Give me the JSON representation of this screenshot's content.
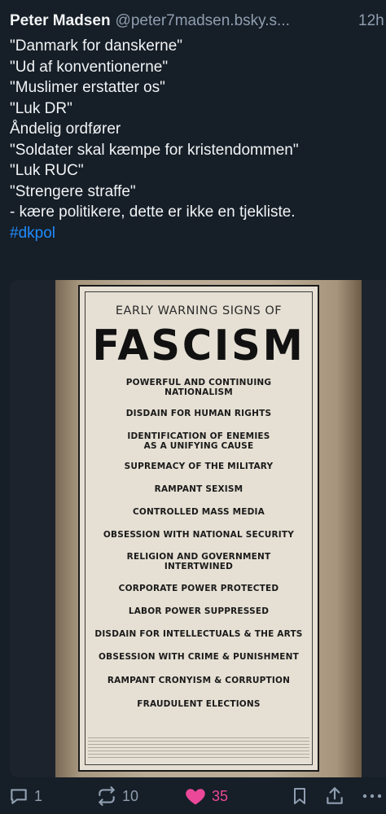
{
  "post": {
    "author_name": "Peter Madsen",
    "author_handle": "@peter7madsen.bsky.s...",
    "time": "12h",
    "lines": [
      "\"Danmark for danskerne\"",
      "\"Ud af konventionerne\"",
      "\"Muslimer erstatter os\"",
      "\"Luk DR\"",
      "Åndelig ordfører",
      "\"Soldater skal kæmpe for kristendommen\"",
      "\"Luk RUC\"",
      "\"Strengere straffe\"",
      " - kære politikere, dette er ikke en tjekliste."
    ],
    "hashtag": "#dkpol"
  },
  "poster": {
    "subtitle": "EARLY WARNING SIGNS OF",
    "title": "FASCISM",
    "signs": [
      "POWERFUL AND CONTINUING\nNATIONALISM",
      "DISDAIN FOR HUMAN RIGHTS",
      "IDENTIFICATION OF ENEMIES\nAS A UNIFYING CAUSE",
      "SUPREMACY OF THE MILITARY",
      "RAMPANT SEXISM",
      "CONTROLLED MASS MEDIA",
      "OBSESSION WITH NATIONAL SECURITY",
      "RELIGION AND GOVERNMENT\nINTERTWINED",
      "CORPORATE POWER PROTECTED",
      "LABOR POWER SUPPRESSED",
      "DISDAIN FOR INTELLECTUALS & THE ARTS",
      "OBSESSION WITH CRIME & PUNISHMENT",
      "RAMPANT CRONYISM & CORRUPTION",
      "FRAUDULENT ELECTIONS"
    ]
  },
  "actions": {
    "reply_count": "1",
    "repost_count": "10",
    "like_count": "35",
    "icons": [
      "reply-icon",
      "repost-icon",
      "heart-icon",
      "bookmark-icon",
      "share-icon",
      "more-icon"
    ],
    "like_color": "#ec4899",
    "muted_color": "#8f9eb0",
    "link_color": "#208bfe"
  }
}
